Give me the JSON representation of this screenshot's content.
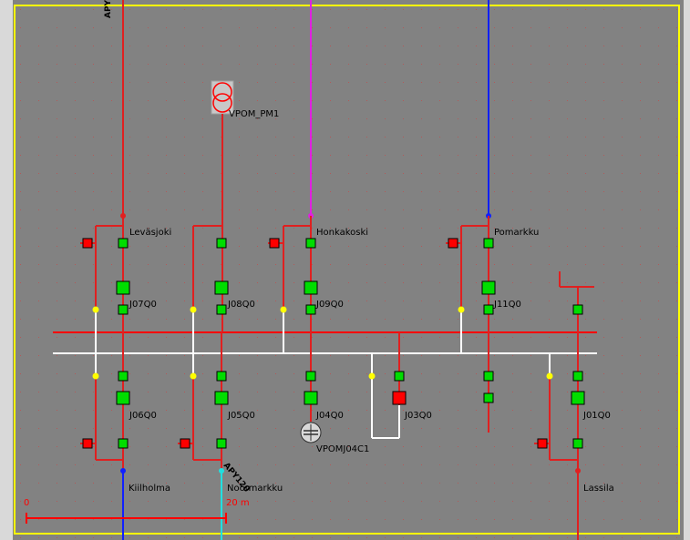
{
  "colors": {
    "background": "#828282",
    "outer": "#d9d9d9",
    "frame": "#ffff00",
    "grid_dot": "#b25a5a",
    "busbar_red": "#ff0000",
    "busbar_white": "#ffffff",
    "feeder_red": "#e02020",
    "feeder_magenta": "#e020e0",
    "feeder_blue": "#1020ff",
    "feeder_cyan": "#20e0e0",
    "breaker_closed": "#00dd00",
    "breaker_open": "#ff0000",
    "node_yellow": "#ffff00",
    "label_text": "#000000",
    "scale_text": "#ff0000"
  },
  "labels": {
    "leavasjoki": "Leväsjoki",
    "honkakoski": "Honkakoski",
    "pomarkku": "Pomarkku",
    "kiilholma": "Kiilholma",
    "noormarkku": "Noormarkku",
    "lassila": "Lassila",
    "transformer": "VPOM_PM1",
    "capacitor": "VPOMJ04C1",
    "apy_top": "APY",
    "apy120": "APY120",
    "bay_j07": "J07Q0",
    "bay_j08": "J08Q0",
    "bay_j09": "J09Q0",
    "bay_j11": "J11Q0",
    "bay_j06": "J06Q0",
    "bay_j05": "J05Q0",
    "bay_j04": "J04Q0",
    "bay_j03": "J03Q0",
    "bay_j01": "J01Q0"
  },
  "scale": {
    "start": "0",
    "end": "20 m"
  }
}
